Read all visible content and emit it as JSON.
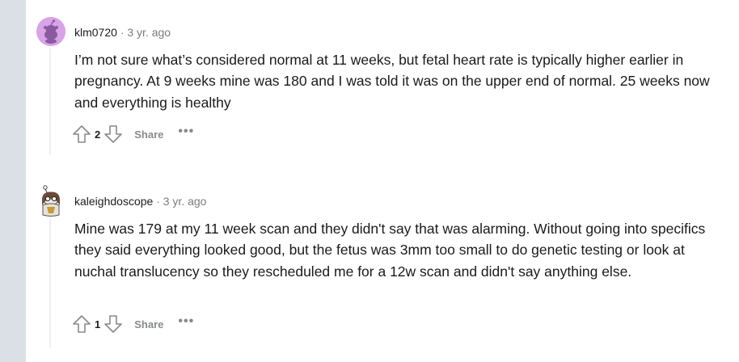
{
  "comments": [
    {
      "author": "klm0720",
      "separator": "·",
      "time": "3 yr. ago",
      "avatar_icon": "snoo-avatar-icon",
      "text": "I’m not sure what’s considered normal at 11 weeks, but fetal heart rate is typically higher earlier in pregnancy. At 9 weeks mine was 180 and I was told it was on the upper end of normal. 25 weeks now and everything is healthy",
      "score": "2",
      "share_label": "Share",
      "more_label": "•••"
    },
    {
      "author": "kaleighdoscope",
      "separator": "·",
      "time": "3 yr. ago",
      "avatar_icon": "custom-snoo-avatar-icon",
      "text": "Mine was 179 at my 11 week scan and they didn't say that was alarming. Without going into specifics they said everything looked good, but the fetus was 3mm too small to do genetic testing or look at nuchal translucency so they rescheduled me for a 12w scan and didn't say anything else.",
      "score": "1",
      "share_label": "Share",
      "more_label": "•••"
    }
  ],
  "colors": {
    "page_bg": "#dae0e6",
    "avatar1_bg": "#d9a3e8",
    "text": "#1a1a1b",
    "muted": "#878a8c"
  }
}
